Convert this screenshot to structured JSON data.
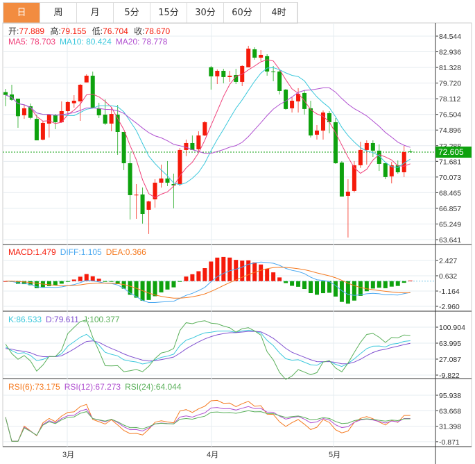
{
  "tabs": [
    "日",
    "周",
    "月",
    "5分",
    "15分",
    "30分",
    "60分",
    "4时"
  ],
  "active_tab": 0,
  "legend": {
    "open_label": "开:",
    "open": "77.889",
    "high_label": "高:",
    "high": "79.155",
    "low_label": "低:",
    "low": "76.704",
    "close_label": "收:",
    "close": "78.670",
    "ma5": "MA5: 78.703",
    "ma10": "MA10: 80.424",
    "ma20": "MA20: 78.778",
    "macd": "MACD:1.479",
    "diff": "DIFF:1.105",
    "dea": "DEA:0.366",
    "k": "K:86.533",
    "d": "D:79.611",
    "j": "J:100.377",
    "rsi6": "RSI(6):73.175",
    "rsi12": "RSI(12):67.273",
    "rsi24": "RSI(24):64.044"
  },
  "current_price": "72.605",
  "colors": {
    "up": "#f51a0a",
    "down": "#0ea20e",
    "ma5": "#f0407a",
    "ma10": "#3cc8dc",
    "ma20": "#b050d0",
    "diff": "#4aa8f0",
    "dea": "#f57a20",
    "k": "#3cc8dc",
    "d": "#8050d0",
    "j": "#5ab05a",
    "rsi6": "#f57a20",
    "rsi12": "#b050d0",
    "rsi24": "#5ab05a",
    "tab_active": "#f28c40"
  },
  "chart_data": {
    "type": "candlestick",
    "x_ticks": [
      "3月",
      "4月",
      "5月"
    ],
    "price_ticks": [
      "84.544",
      "82.936",
      "81.328",
      "79.720",
      "78.112",
      "76.504",
      "74.896",
      "73.288",
      "71.681",
      "70.073",
      "68.465",
      "66.857",
      "65.249",
      "63.641"
    ],
    "macd_ticks": [
      "2.427",
      "0.632",
      "-1.164",
      "-2.960"
    ],
    "kdj_ticks": [
      "100.904",
      "63.995",
      "27.087",
      "-9.822"
    ],
    "rsi_ticks": [
      "95.938",
      "63.668",
      "31.398",
      "-0.871"
    ],
    "price_range": [
      63.641,
      84.544
    ],
    "candles_ohlc": [
      [
        78.79,
        79.12,
        77.34,
        78.5
      ],
      [
        78.55,
        79.55,
        77.91,
        78.0
      ],
      [
        78.12,
        78.12,
        75.13,
        76.32
      ],
      [
        76.41,
        77.48,
        76.05,
        77.13
      ],
      [
        77.34,
        77.62,
        75.98,
        76.15
      ],
      [
        76.05,
        76.48,
        73.84,
        73.84
      ],
      [
        73.91,
        75.84,
        73.84,
        75.63
      ],
      [
        75.56,
        76.55,
        74.13,
        76.48
      ],
      [
        76.41,
        76.55,
        74.99,
        75.7
      ],
      [
        75.7,
        77.84,
        75.63,
        76.84
      ],
      [
        76.84,
        77.84,
        76.55,
        77.77
      ],
      [
        77.65,
        78.48,
        77.2,
        77.91
      ],
      [
        77.84,
        79.62,
        75.84,
        79.55
      ],
      [
        79.79,
        80.62,
        79.79,
        80.48
      ],
      [
        80.48,
        80.9,
        77.2,
        77.2
      ],
      [
        77.13,
        77.7,
        76.13,
        76.41
      ],
      [
        76.48,
        78.05,
        75.41,
        75.56
      ],
      [
        75.56,
        77.27,
        74.77,
        76.55
      ],
      [
        76.48,
        77.48,
        72.35,
        74.7
      ],
      [
        74.7,
        74.7,
        70.78,
        71.49
      ],
      [
        71.49,
        72.56,
        65.71,
        68.21
      ],
      [
        68.23,
        69.35,
        65.78,
        68.26
      ],
      [
        68.28,
        69.0,
        65.29,
        66.28
      ],
      [
        66.71,
        67.64,
        64.22,
        67.57
      ],
      [
        67.78,
        69.85,
        66.93,
        69.49
      ],
      [
        69.49,
        71.35,
        68.99,
        69.92
      ],
      [
        69.92,
        71.71,
        69.14,
        69.49
      ],
      [
        69.35,
        70.42,
        66.86,
        69.21
      ],
      [
        69.35,
        73.06,
        69.14,
        72.85
      ],
      [
        72.85,
        73.92,
        72.21,
        73.56
      ],
      [
        73.56,
        74.34,
        72.85,
        72.85
      ],
      [
        72.92,
        74.77,
        72.7,
        74.34
      ],
      [
        74.34,
        75.84,
        74.27,
        75.7
      ],
      [
        81.34,
        81.48,
        79.05,
        80.41
      ],
      [
        80.41,
        81.12,
        79.62,
        80.98
      ],
      [
        80.98,
        81.19,
        79.7,
        80.34
      ],
      [
        80.34,
        80.98,
        79.84,
        80.48
      ],
      [
        80.55,
        81.19,
        79.62,
        79.84
      ],
      [
        79.84,
        81.55,
        79.41,
        81.48
      ],
      [
        81.34,
        83.55,
        81.34,
        83.26
      ],
      [
        83.19,
        83.4,
        82.12,
        82.33
      ],
      [
        82.33,
        83.12,
        81.98,
        82.62
      ],
      [
        82.48,
        82.69,
        80.48,
        80.91
      ],
      [
        80.91,
        81.48,
        79.91,
        80.84
      ],
      [
        80.91,
        81.05,
        78.55,
        78.91
      ],
      [
        79.05,
        79.12,
        76.98,
        77.06
      ],
      [
        77.13,
        78.27,
        76.7,
        77.91
      ],
      [
        77.84,
        79.2,
        76.7,
        78.62
      ],
      [
        78.7,
        78.98,
        76.48,
        77.06
      ],
      [
        77.13,
        77.91,
        74.13,
        74.34
      ],
      [
        74.42,
        75.41,
        73.92,
        74.84
      ],
      [
        74.84,
        76.91,
        73.92,
        76.7
      ],
      [
        76.63,
        76.84,
        74.56,
        75.7
      ],
      [
        75.7,
        76.13,
        71.42,
        71.49
      ],
      [
        71.56,
        71.71,
        68.07,
        68.07
      ],
      [
        68.14,
        69.85,
        63.86,
        68.57
      ],
      [
        68.64,
        71.71,
        68.5,
        71.28
      ],
      [
        71.28,
        73.7,
        71.0,
        72.85
      ],
      [
        72.85,
        73.84,
        71.35,
        73.56
      ],
      [
        73.56,
        73.84,
        72.13,
        72.78
      ],
      [
        72.78,
        73.42,
        70.7,
        71.42
      ],
      [
        71.49,
        71.49,
        69.85,
        70.07
      ],
      [
        70.14,
        71.63,
        69.42,
        71.28
      ],
      [
        71.28,
        71.78,
        70.42,
        70.56
      ],
      [
        70.56,
        73.27,
        70.07,
        72.63
      ],
      [
        72.7,
        72.92,
        72.56,
        72.63
      ]
    ]
  }
}
